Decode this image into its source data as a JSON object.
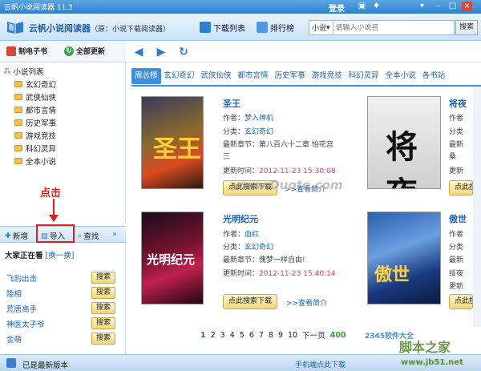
{
  "window": {
    "title": "云帆小说阅读器 11.3",
    "login": "登录"
  },
  "header": {
    "logo_text": "云帆小说阅读器",
    "logo_sub": "（原：小说下载阅读器）",
    "nav": [
      {
        "label": "下载列表",
        "icon": "download-list-icon"
      },
      {
        "label": "排行榜",
        "icon": "ranking-icon"
      }
    ],
    "search": {
      "category": "小说",
      "placeholder": "请输入小说名",
      "button": "搜索"
    }
  },
  "left_toolbar": {
    "make_ebook": "制电子书",
    "update_all": "全部更新"
  },
  "tree": {
    "root": "小说列表",
    "items": [
      "玄幻奇幻",
      "武侠仙侠",
      "都市言情",
      "历史军事",
      "游戏竞技",
      "科幻灵异",
      "全本小说"
    ]
  },
  "annotation": "点击",
  "left_bar": {
    "add": "新增",
    "import": "导入",
    "find": "查找"
  },
  "reading": {
    "header": "大家正在看",
    "refresh": "[换一换]",
    "items": [
      "飞豹出击",
      "隐相",
      "荒唐高手",
      "神医太子爷",
      "金萌"
    ],
    "button": "搜索"
  },
  "tabs": [
    "周总榜",
    "玄幻奇幻",
    "武侠仙侠",
    "都市言情",
    "历史军事",
    "游戏竞技",
    "科幻灵异",
    "全本小说",
    "各书站"
  ],
  "books": [
    {
      "title": "圣王",
      "author": "梦入神机",
      "category": "玄幻奇幻",
      "latest": "第八百六十二章 怡花宫",
      "latest_cont": "三",
      "updated": "2012-11-23 15:30:08"
    },
    {
      "title": "光明纪元",
      "author": "血红",
      "category": "玄幻奇幻",
      "latest": "傀梦一样自由!",
      "updated": "2012-11-23 15:40:14"
    }
  ],
  "right_books": [
    {
      "title": "将夜",
      "lines": [
        "作者",
        "分类",
        "最新",
        "桑",
        "更新"
      ]
    },
    {
      "title": "傲世",
      "lines": [
        "作者",
        "分类",
        "最新",
        "绥夜",
        "更新"
      ]
    }
  ],
  "labels": {
    "author": "作者：",
    "category": "分类：",
    "latest": "最新章节：",
    "updated": "更新时间：",
    "search_download": "点此搜索下载",
    "view_intro": ">>查看简介",
    "cover_2_caption": "光明纪元"
  },
  "pager": {
    "pages": [
      "1",
      "2",
      "3",
      "4",
      "5",
      "6",
      "7",
      "8",
      "9",
      "10"
    ],
    "next": "下一页",
    "total": "400"
  },
  "status": {
    "left": "已是最新版本",
    "mid": "手机端点此下载"
  },
  "watermarks": {
    "w1": "www.Duote.com",
    "w2": "2345软件大全",
    "w3": "脚本之家",
    "w4": "www.jb51.net"
  }
}
